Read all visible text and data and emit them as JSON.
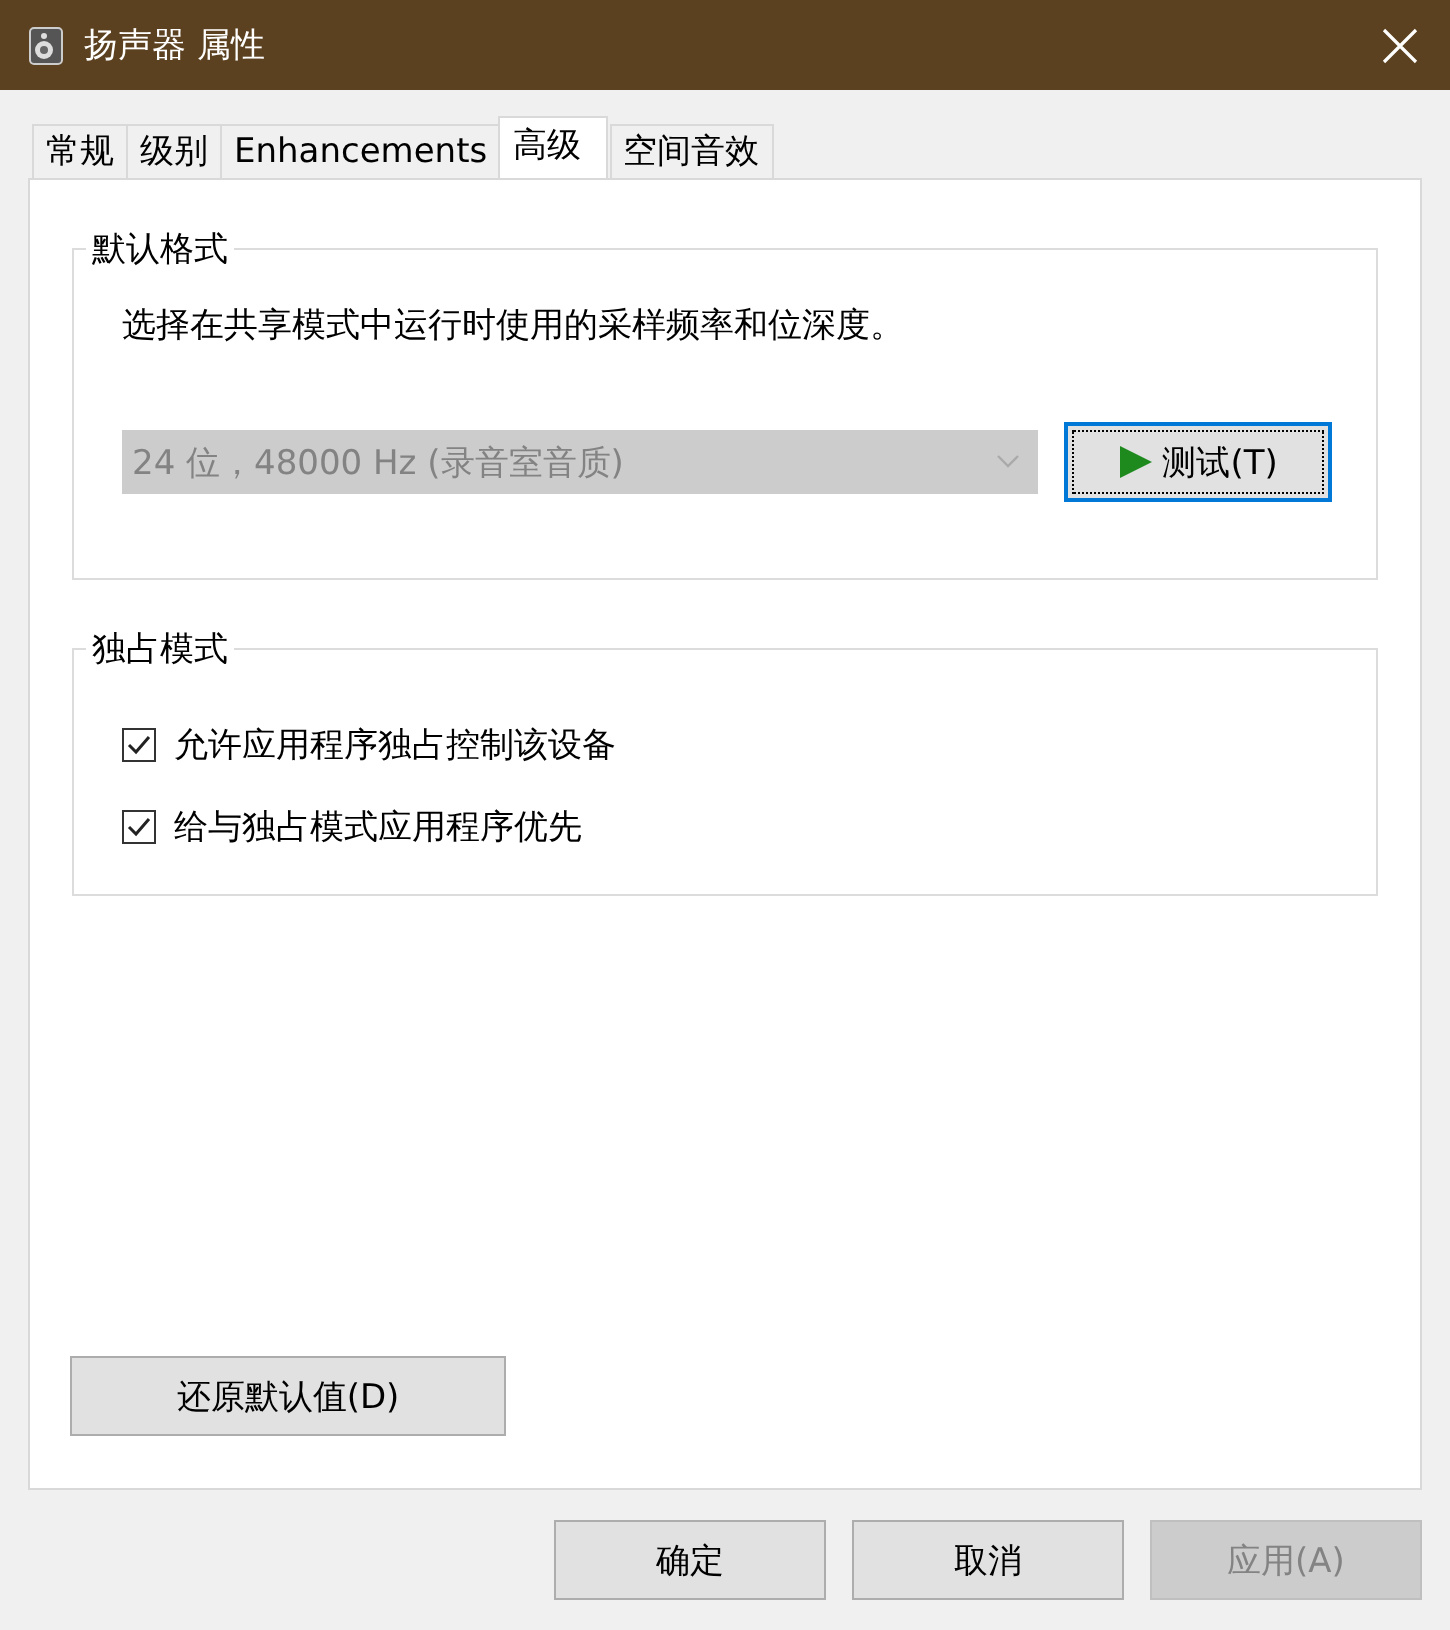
{
  "window": {
    "title": "扬声器 属性"
  },
  "tabs": [
    {
      "label": "常规",
      "selected": false
    },
    {
      "label": "级别",
      "selected": false
    },
    {
      "label": "Enhancements",
      "selected": false
    },
    {
      "label": "高级",
      "selected": true
    },
    {
      "label": "空间音效",
      "selected": false
    }
  ],
  "default_format": {
    "title": "默认格式",
    "description": "选择在共享模式中运行时使用的采样频率和位深度。",
    "dropdown": {
      "value": "24 位，48000 Hz (录音室音质)",
      "disabled": true
    },
    "test_button": {
      "label": "测试(T)",
      "focused": true
    }
  },
  "exclusive_mode": {
    "title": "独占模式",
    "options": [
      {
        "label": "允许应用程序独占控制该设备",
        "checked": true
      },
      {
        "label": "给与独占模式应用程序优先",
        "checked": true
      }
    ]
  },
  "restore_button": {
    "label": "还原默认值(D)"
  },
  "buttons": [
    {
      "label": "确定",
      "disabled": false
    },
    {
      "label": "取消",
      "disabled": false
    },
    {
      "label": "应用(A)",
      "disabled": true
    }
  ]
}
